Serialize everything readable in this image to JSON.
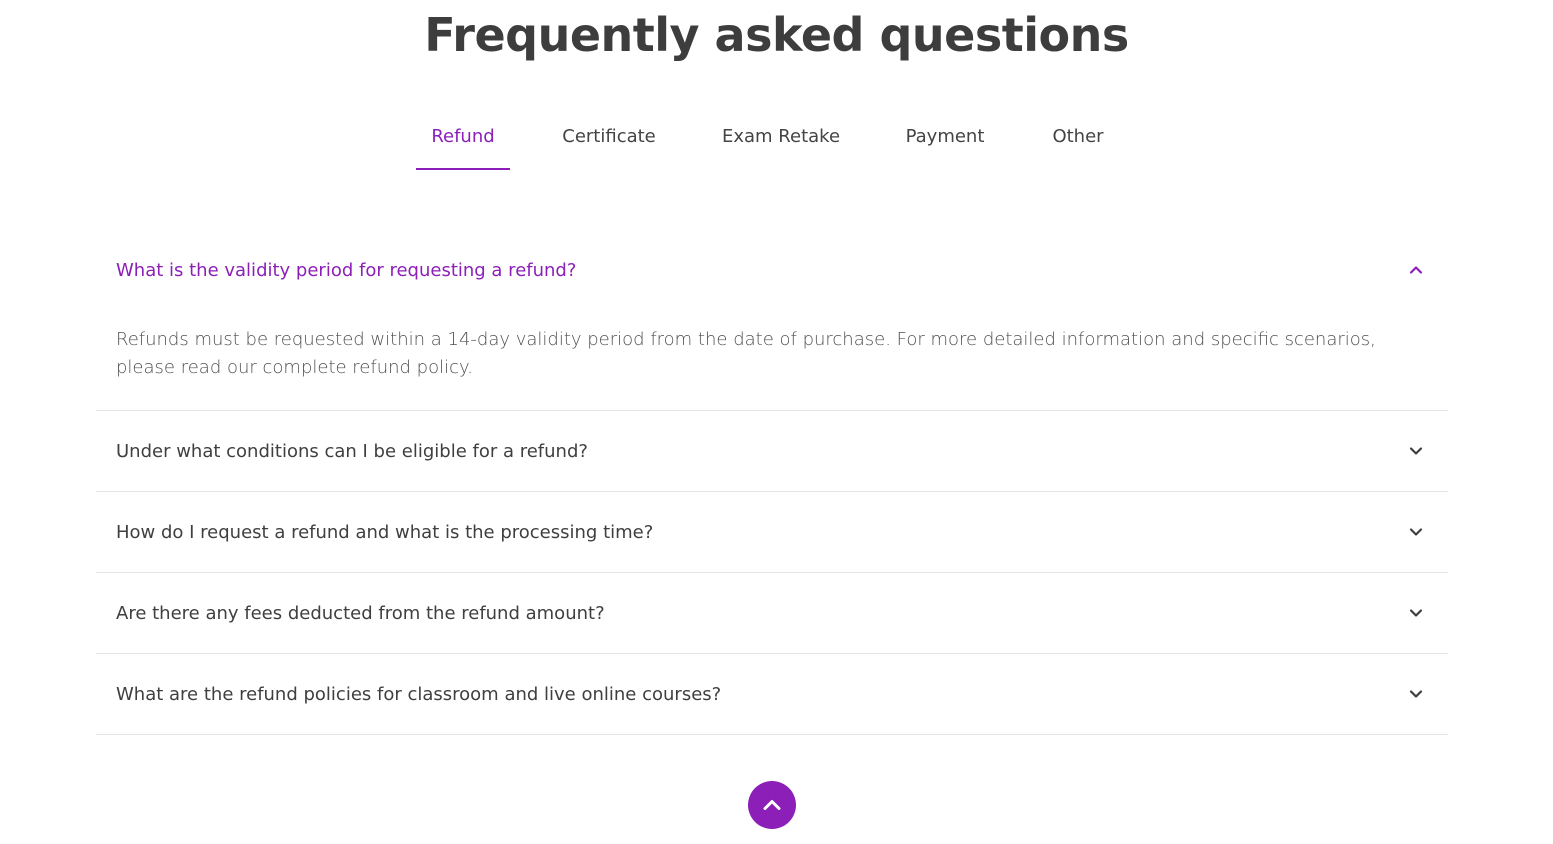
{
  "page": {
    "title": "Frequently asked questions"
  },
  "tabs": [
    {
      "label": "Refund",
      "active": true
    },
    {
      "label": "Certificate",
      "active": false
    },
    {
      "label": "Exam Retake",
      "active": false
    },
    {
      "label": "Payment",
      "active": false
    },
    {
      "label": "Other",
      "active": false
    }
  ],
  "faq": [
    {
      "question": "What is the validity period for requesting a refund?",
      "answer": "Refunds must be requested within a 14-day validity period from the date of purchase. For more detailed information and specific scenarios, please read our complete refund policy.",
      "open": true
    },
    {
      "question": "Under what conditions can I be eligible for a refund?",
      "open": false
    },
    {
      "question": "How do I request a refund and what is the processing time?",
      "open": false
    },
    {
      "question": "Are there any fees deducted from the refund amount?",
      "open": false
    },
    {
      "question": "What are the refund policies for classroom and live online courses?",
      "open": false
    }
  ],
  "icons": {
    "open_item": "chevron-up-icon",
    "closed_item": "chevron-down-icon",
    "scroll_top": "arrow-up-icon"
  },
  "colors": {
    "accent": "#8b1fb8",
    "text": "#3f3f3f",
    "divider": "#e5e5e5"
  }
}
